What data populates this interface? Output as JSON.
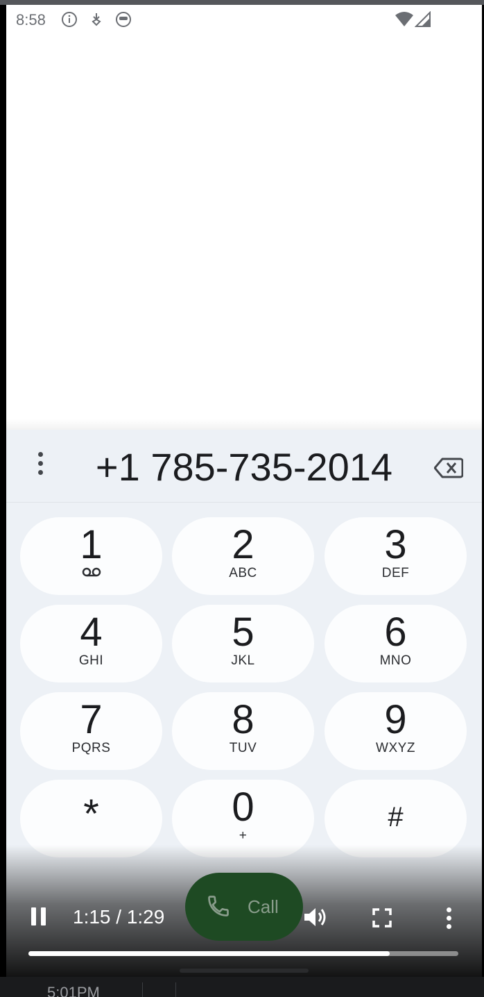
{
  "status_bar": {
    "time": "8:58",
    "left_icons": [
      "info-icon",
      "download-icon",
      "face-icon"
    ],
    "right_icons": [
      "wifi-icon",
      "cell-signal-icon"
    ]
  },
  "dialer": {
    "number": "+1 785-735-2014",
    "menu_icon": "more-vert-icon",
    "backspace_icon": "backspace-icon",
    "keys": [
      {
        "digit": "1",
        "letters": "",
        "icon": "voicemail-icon"
      },
      {
        "digit": "2",
        "letters": "ABC"
      },
      {
        "digit": "3",
        "letters": "DEF"
      },
      {
        "digit": "4",
        "letters": "GHI"
      },
      {
        "digit": "5",
        "letters": "JKL"
      },
      {
        "digit": "6",
        "letters": "MNO"
      },
      {
        "digit": "7",
        "letters": "PQRS"
      },
      {
        "digit": "8",
        "letters": "TUV"
      },
      {
        "digit": "9",
        "letters": "WXYZ"
      },
      {
        "digit": "*",
        "letters": ""
      },
      {
        "digit": "0",
        "letters": "+"
      },
      {
        "digit": "#",
        "letters": ""
      }
    ],
    "call_label": "Call",
    "call_color": "#1e4a23"
  },
  "video_player": {
    "time": "1:15 / 1:29",
    "progress": 0.84,
    "icons": [
      "pause-icon",
      "volume-icon",
      "fullscreen-icon",
      "more-vert-icon"
    ]
  },
  "bottom_strip": {
    "time": "5:01PM"
  }
}
